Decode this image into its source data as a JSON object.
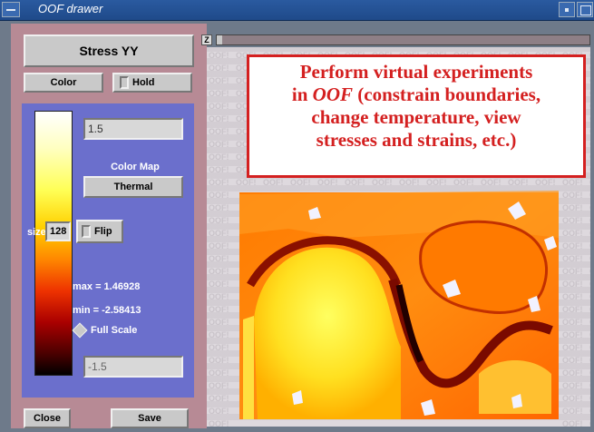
{
  "window": {
    "title": "OOF drawer"
  },
  "left_panel": {
    "quantity_button": "Stress YY",
    "color_button": "Color",
    "hold_toggle": "Hold",
    "upper_limit": "1.5",
    "color_map_label": "Color Map",
    "color_map_value": "Thermal",
    "size_label": "size",
    "size_value": "128",
    "flip_button": "Flip",
    "max_text": "max = 1.46928",
    "min_text": "min = -2.58413",
    "full_scale_label": "Full Scale",
    "lower_limit": "-1.5",
    "close_button": "Close",
    "save_button": "Save"
  },
  "view": {
    "zoom_label": "Z",
    "watermark": "OOF!",
    "callout": {
      "line1": "Perform virtual experiments",
      "line2_pre": "in ",
      "line2_ital": "OOF",
      "line2_post": " (constrain boundaries,",
      "line3": "change temperature, view",
      "line4": "stresses and strains, etc.)"
    }
  },
  "colors": {
    "accent_red": "#d42020",
    "panel_pink": "#b78a95",
    "panel_blue": "#6b6fcc"
  }
}
